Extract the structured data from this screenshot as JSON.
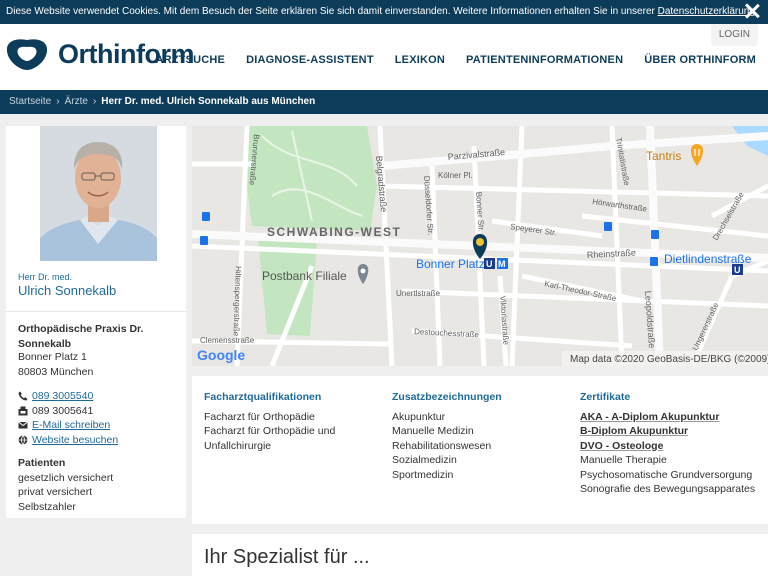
{
  "cookie": {
    "text": "Diese Website verwendet Cookies. Mit dem Besuch der Seite erklären Sie sich damit einverstanden. Weitere Informationen erhalten Sie in unserer ",
    "link": "Datenschutzerklärung",
    "suffix": "."
  },
  "header": {
    "logo": "Orthinform",
    "login": "LOGIN",
    "nav": [
      "ARZTSUCHE",
      "DIAGNOSE-ASSISTENT",
      "LEXIKON",
      "PATIENTENINFORMATIONEN",
      "ÜBER ORTHINFORM"
    ]
  },
  "breadcrumb": {
    "items": [
      "Startseite",
      "Ärzte"
    ],
    "current": "Herr Dr. med. Ulrich Sonnekalb aus München"
  },
  "doctor": {
    "title": "Herr Dr. med.",
    "name": "Ulrich Sonnekalb",
    "practice": "Orthopädische Praxis Dr. Sonnekalb",
    "street": "Bonner Platz 1",
    "city": "80803 München",
    "phone": "089 3005540",
    "fax": "089 3005641",
    "email": "E-Mail schreiben",
    "website": "Website besuchen"
  },
  "patients": {
    "heading": "Patienten",
    "items": [
      "gesetzlich versichert",
      "privat versichert",
      "Selbstzahler"
    ]
  },
  "map": {
    "labels": {
      "schwabing": "SCHWABING-WEST",
      "bonner": "Bonner Platz",
      "postbank": "Postbank Filiale",
      "dietlinden": "Dietlindenstraße",
      "tantris": "Tantris",
      "parzival": "Parzivalstraße",
      "belgrad": "Belgradstraße",
      "rhein": "Rheinstraße",
      "leopold": "Leopoldstraße",
      "karltheodor": "Karl-Theodor-Straße",
      "destouches": "Destouchesstraße",
      "clemens": "Clemensstraße",
      "unerti": "Unertlstraße",
      "hohenzollern": "Hörwarthstraße",
      "speyerer": "Speyerer Str.",
      "duesseldorfer": "Düsseldorfer Str.",
      "viktoria": "Viktoriastraße",
      "bonnerstr": "Bonner Str.",
      "koelner": "Kölner Pl.",
      "brunnen": "Brunnerstraße",
      "hiltensperger": "Hiltenspergerstraße",
      "trinitas": "Trinitatistraße",
      "drechsel": "Drechselstraße",
      "unger": "Ungererstraße"
    },
    "google": "Google",
    "attribution": "Map data ©2020 GeoBasis-DE/BKG (©2009)"
  },
  "qualifications": {
    "heading": "Facharztqualifikationen",
    "items": [
      "Facharzt für Orthopädie",
      "Facharzt für Orthopädie und Unfallchirurgie"
    ]
  },
  "additional": {
    "heading": "Zusatzbezeichnungen",
    "items": [
      "Akupunktur",
      "Manuelle Medizin",
      "Rehabilitationswesen",
      "Sozialmedizin",
      "Sportmedizin"
    ]
  },
  "certificates": {
    "heading": "Zertifikate",
    "linked": [
      "AKA - A-Diplom Akupunktur",
      "B-Diplom Akupunktur",
      "DVO - Osteologe"
    ],
    "items": [
      "Manuelle Therapie",
      "Psychosomatische Grundversorgung",
      "Sonografie des Bewegungsapparates"
    ]
  },
  "specialist": {
    "heading": "Ihr Spezialist für ..."
  },
  "colors": {
    "brand": "#0d3c5a",
    "link": "#1f6a99"
  }
}
